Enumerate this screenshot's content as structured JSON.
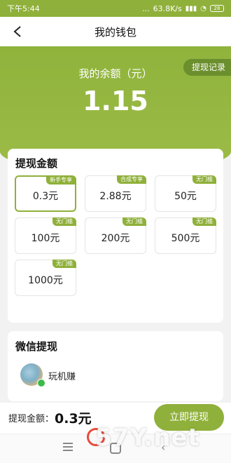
{
  "status_bar": {
    "time": "下午5:44",
    "dots": "...",
    "speed": "63.8K/s",
    "battery": "28"
  },
  "navbar": {
    "title": "我的钱包"
  },
  "balance": {
    "label": "我的余额（元）",
    "value": "1.15",
    "record_button": "提现记录"
  },
  "amount_section": {
    "title": "提现金额",
    "options": [
      {
        "amount": "0.3元",
        "badge": "新手专享",
        "selected": true
      },
      {
        "amount": "2.88元",
        "badge": "合成专享",
        "selected": false
      },
      {
        "amount": "50元",
        "badge": "无门槛",
        "selected": false
      },
      {
        "amount": "100元",
        "badge": "无门槛",
        "selected": false
      },
      {
        "amount": "200元",
        "badge": "无门槛",
        "selected": false
      },
      {
        "amount": "500元",
        "badge": "无门槛",
        "selected": false
      },
      {
        "amount": "1000元",
        "badge": "无门槛",
        "selected": false
      }
    ]
  },
  "wechat_section": {
    "title": "微信提现",
    "nickname": "玩机赚"
  },
  "bottom_bar": {
    "label": "提现金额：",
    "amount": "0.3元",
    "button": "立即提现"
  },
  "watermark": {
    "text": "57Y.net"
  },
  "colors": {
    "accent": "#8fb03a",
    "accent_dark": "#6b8f2d"
  }
}
